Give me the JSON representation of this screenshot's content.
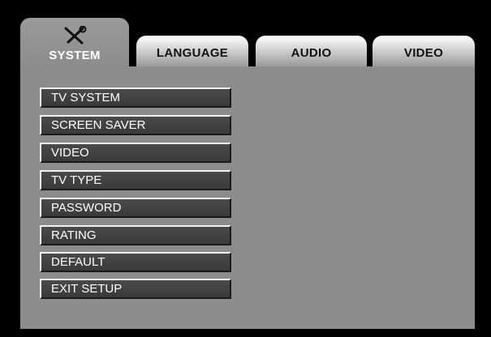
{
  "tabs": {
    "system": "SYSTEM",
    "language": "LANGUAGE",
    "audio": "AUDIO",
    "video": "VIDEO",
    "active": "SYSTEM",
    "active_icon": "tools-icon"
  },
  "menu": {
    "items": [
      "TV SYSTEM",
      "SCREEN SAVER",
      "VIDEO",
      "TV TYPE",
      "PASSWORD",
      "RATING",
      "DEFAULT",
      "EXIT SETUP"
    ]
  },
  "colors": {
    "background": "#000000",
    "panel": "#8c8c8c",
    "button": "#444444",
    "button_text": "#ffffff",
    "tab_inactive": "#d9d9d9"
  }
}
